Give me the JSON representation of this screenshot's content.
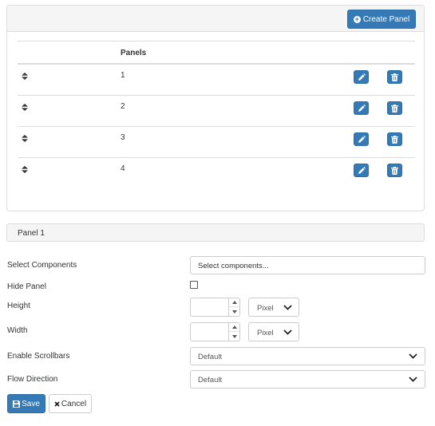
{
  "panels_card": {
    "create_button_label": "Create Panel",
    "column_header": "Panels",
    "rows": [
      {
        "label": "1"
      },
      {
        "label": "2"
      },
      {
        "label": "3"
      },
      {
        "label": "4"
      }
    ]
  },
  "panel_section": {
    "title": "Panel 1"
  },
  "form": {
    "select_components": {
      "label": "Select Components",
      "placeholder": "Select components..."
    },
    "hide_panel": {
      "label": "Hide Panel",
      "checked": false
    },
    "height": {
      "label": "Height",
      "value": "",
      "unit": "Pixel"
    },
    "width": {
      "label": "Width",
      "value": "",
      "unit": "Pixel"
    },
    "enable_scrollbars": {
      "label": "Enable Scrollbars",
      "value": "Default"
    },
    "flow_direction": {
      "label": "Flow Direction",
      "value": "Default"
    }
  },
  "actions": {
    "save_label": "Save",
    "cancel_label": "Cancel"
  },
  "colors": {
    "primary": "#337ab7",
    "panel_header_bg": "#f5f5f5",
    "border": "#dddddd"
  }
}
